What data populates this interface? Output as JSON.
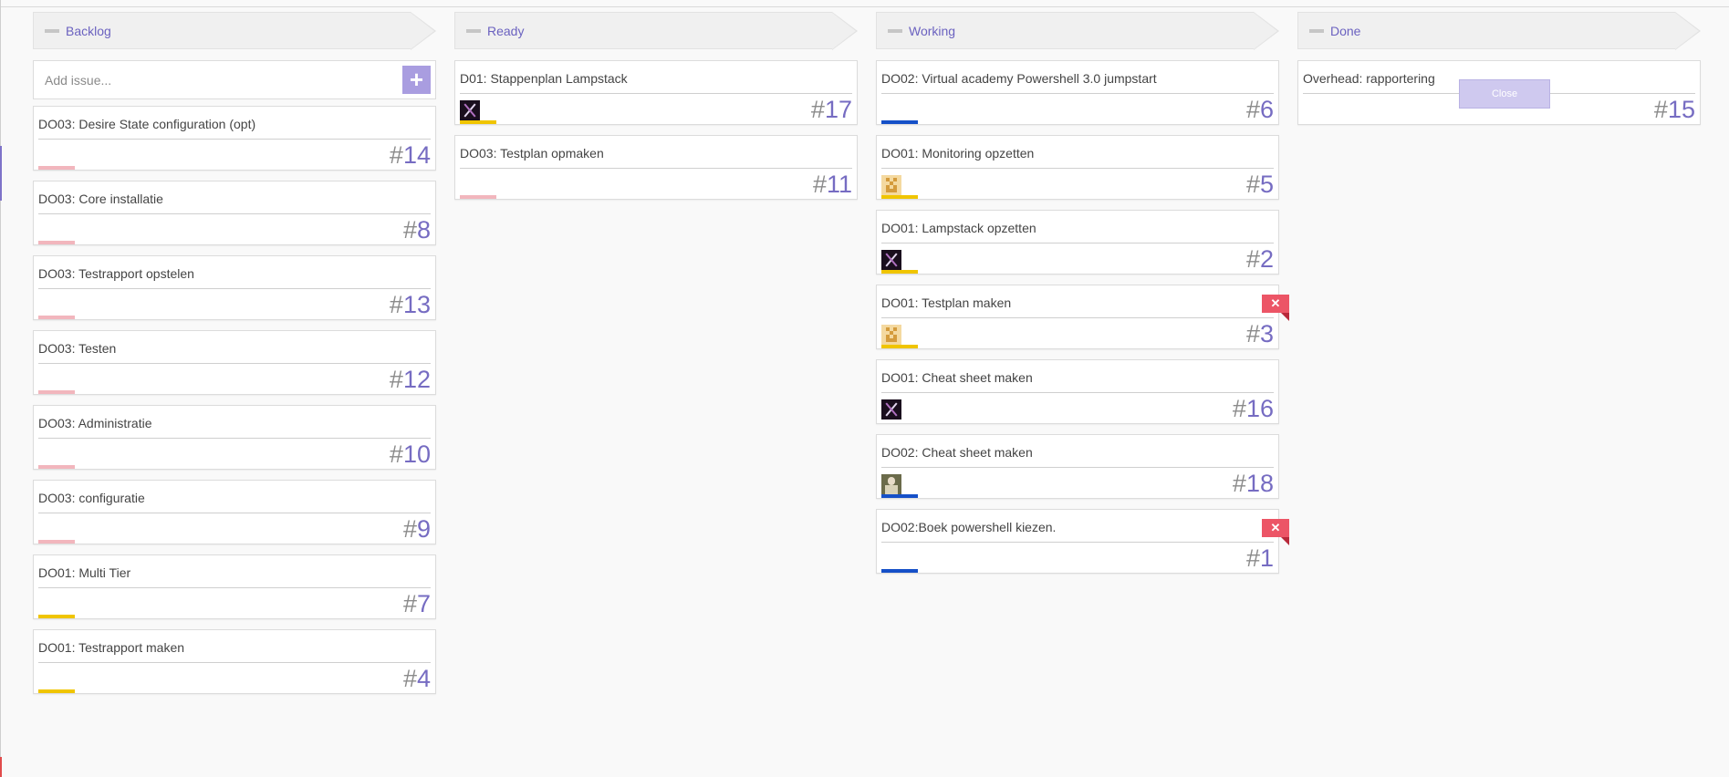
{
  "colors": {
    "accent": "#766cc2",
    "header_text": "#6b62c0",
    "bar_pink": "#f2b6bd",
    "bar_yellow": "#f0c500",
    "bar_blue": "#1550c8",
    "close_red": "#ec5566"
  },
  "columns": [
    {
      "title": "Backlog",
      "add_placeholder": "Add issue...",
      "add_icon": "plus-icon",
      "cards": [
        {
          "title": "DO03: Desire State configuration (opt)",
          "hash": "#",
          "number": "14",
          "bar": "pink"
        },
        {
          "title": "DO03: Core installatie",
          "hash": "#",
          "number": "8",
          "bar": "pink"
        },
        {
          "title": "DO03: Testrapport opstelen",
          "hash": "#",
          "number": "13",
          "bar": "pink"
        },
        {
          "title": "DO03: Testen",
          "hash": "#",
          "number": "12",
          "bar": "pink"
        },
        {
          "title": "DO03: Administratie",
          "hash": "#",
          "number": "10",
          "bar": "pink"
        },
        {
          "title": "DO03: configuratie",
          "hash": "#",
          "number": "9",
          "bar": "pink"
        },
        {
          "title": "DO01: Multi Tier",
          "hash": "#",
          "number": "7",
          "bar": "yellow"
        },
        {
          "title": "DO01: Testrapport maken",
          "hash": "#",
          "number": "4",
          "bar": "yellow"
        }
      ]
    },
    {
      "title": "Ready",
      "cards": [
        {
          "title": "D01: Stappenplan Lampstack",
          "hash": "#",
          "number": "17",
          "bar": "yellow",
          "avatar": "dark"
        },
        {
          "title": "DO03: Testplan opmaken",
          "hash": "#",
          "number": "11",
          "bar": "pink"
        }
      ]
    },
    {
      "title": "Working",
      "cards": [
        {
          "title": "DO02: Virtual academy Powershell 3.0 jumpstart",
          "hash": "#",
          "number": "6",
          "bar": "blue"
        },
        {
          "title": "DO01: Monitoring opzetten",
          "hash": "#",
          "number": "5",
          "bar": "yellow",
          "avatar": "pix"
        },
        {
          "title": "DO01: Lampstack opzetten",
          "hash": "#",
          "number": "2",
          "bar": "yellow",
          "avatar": "dark"
        },
        {
          "title": "DO01: Testplan maken",
          "hash": "#",
          "number": "3",
          "bar": "yellow",
          "avatar": "pix",
          "close_badge": "✕"
        },
        {
          "title": "DO01: Cheat sheet maken",
          "hash": "#",
          "number": "16",
          "bar": "none",
          "avatar": "dark"
        },
        {
          "title": "DO02: Cheat sheet maken",
          "hash": "#",
          "number": "18",
          "bar": "blue",
          "avatar": "photo"
        },
        {
          "title": "DO02:Boek powershell kiezen.",
          "hash": "#",
          "number": "1",
          "bar": "blue",
          "close_badge": "✕"
        }
      ]
    },
    {
      "title": "Done",
      "cards": [
        {
          "title": "Overhead: rapportering",
          "hash": "#",
          "number": "15",
          "bar": "none",
          "close_button": "Close"
        }
      ]
    }
  ]
}
